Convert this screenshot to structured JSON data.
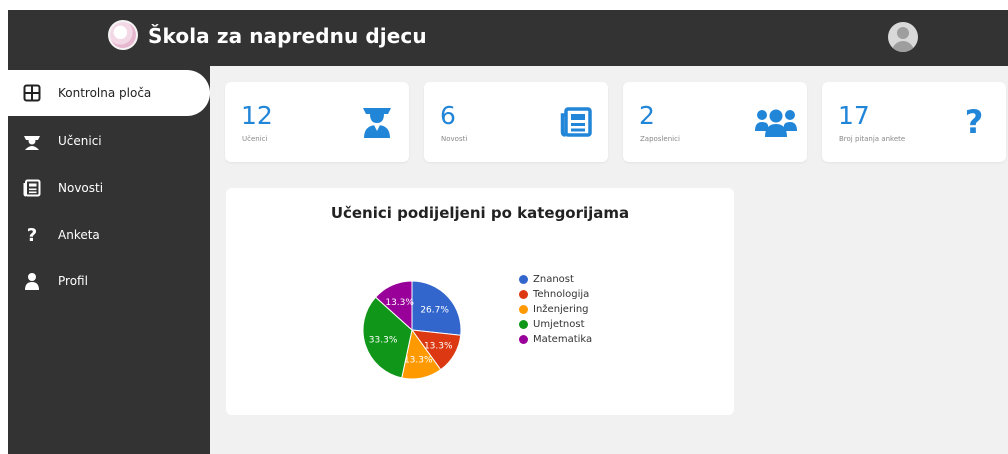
{
  "header": {
    "title": "Škola za naprednu djecu"
  },
  "sidebar": {
    "items": [
      {
        "label": "Kontrolna ploča",
        "icon": "dashboard-icon"
      },
      {
        "label": "Učenici",
        "icon": "student-icon"
      },
      {
        "label": "Novosti",
        "icon": "newspaper-icon"
      },
      {
        "label": "Anketa",
        "icon": "question-icon"
      },
      {
        "label": "Profil",
        "icon": "user-icon"
      }
    ]
  },
  "cards": [
    {
      "value": "12",
      "label": "Učenici",
      "icon": "student-icon"
    },
    {
      "value": "6",
      "label": "Novosti",
      "icon": "newspaper-icon"
    },
    {
      "value": "2",
      "label": "Zaposlenici",
      "icon": "users-icon"
    },
    {
      "value": "17",
      "label": "Broj pitanja ankete",
      "icon": "question-icon"
    }
  ],
  "colors": {
    "accent": "#2185d8",
    "dark": "#333333"
  },
  "chart_data": {
    "type": "pie",
    "title": "Učenici podijeljeni po kategorijama",
    "categories": [
      "Znanost",
      "Tehnologija",
      "Inženjering",
      "Umjetnost",
      "Matematika"
    ],
    "values": [
      26.7,
      13.3,
      13.3,
      33.3,
      13.3
    ],
    "labels": [
      "26.7%",
      "13.3%",
      "13.3%",
      "33.3%",
      "13.3%"
    ],
    "colors": [
      "#3366cc",
      "#dc3912",
      "#ff9900",
      "#109618",
      "#990099"
    ],
    "legend": "right"
  }
}
